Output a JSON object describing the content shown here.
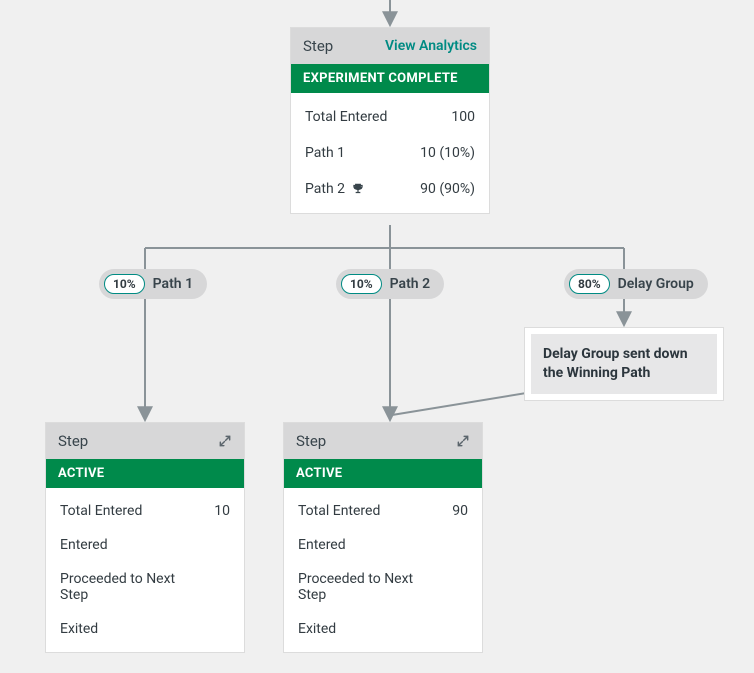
{
  "top": {
    "title": "Step",
    "link": "View Analytics",
    "status": "EXPERIMENT COMPLETE",
    "rows": {
      "total_label": "Total Entered",
      "total_value": "100",
      "p1_label": "Path 1",
      "p1_value": "10 (10%)",
      "p2_label": "Path 2",
      "p2_value": "90 (90%)"
    }
  },
  "pills": {
    "p1": {
      "pct": "10%",
      "label": "Path 1"
    },
    "p2": {
      "pct": "10%",
      "label": "Path 2"
    },
    "delay": {
      "pct": "80%",
      "label": "Delay Group"
    }
  },
  "note": "Delay Group sent down the Winning Path",
  "left": {
    "title": "Step",
    "status": "ACTIVE",
    "rows": {
      "total_label": "Total Entered",
      "total_value": "10",
      "entered": "Entered",
      "proceeded": "Proceeded to Next Step",
      "exited": "Exited"
    }
  },
  "right": {
    "title": "Step",
    "status": "ACTIVE",
    "rows": {
      "total_label": "Total Entered",
      "total_value": "90",
      "entered": "Entered",
      "proceeded": "Proceeded to Next Step",
      "exited": "Exited"
    }
  }
}
